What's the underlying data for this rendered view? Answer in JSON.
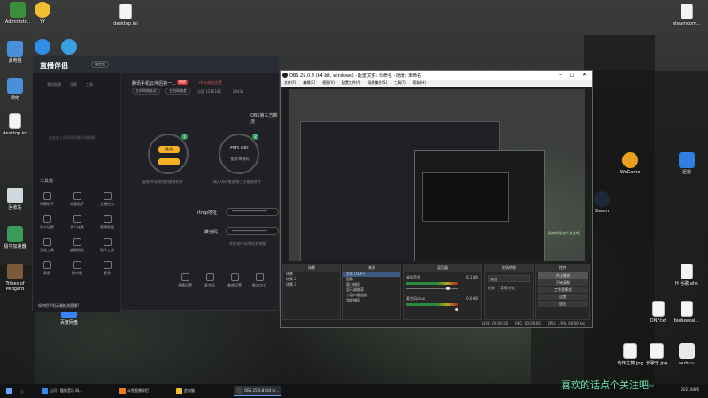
{
  "desktop": {
    "icons": [
      {
        "label": "Administr...",
        "color": "#3a8f3a"
      },
      {
        "label": "YY",
        "color": "#f0c030"
      },
      {
        "label": "desktop.ini",
        "color": "#f4f4f4"
      },
      {
        "label": "steamcom...",
        "color": "#f4f4f4"
      },
      {
        "label": "此电脑",
        "color": "#4a90d9"
      },
      {
        "label": "网络",
        "color": "#4a90d9"
      },
      {
        "label": "desktop.ini",
        "color": "#f4f4f4"
      },
      {
        "label": "回收站",
        "color": "#cfd8dc"
      },
      {
        "label": "极牛加速器",
        "color": "#3a9a5a"
      },
      {
        "label": "Tribes of Midgard",
        "color": "#7a5a3a"
      },
      {
        "label": "百度网盘",
        "color": "#3b82f6"
      },
      {
        "label": "WeGame",
        "color": "#e8a020"
      },
      {
        "label": "迅雷",
        "color": "#2f7fe0"
      },
      {
        "label": "Steam",
        "color": "#1b2838"
      },
      {
        "label": "H 谷歌.ahk",
        "color": "#f4f4f4"
      },
      {
        "label": "DNF.txt",
        "color": "#f4f4f4"
      },
      {
        "label": "bieluwkai...",
        "color": "#f4f4f4"
      },
      {
        "label": "动作之势.jpg",
        "color": "#f4f4f4"
      },
      {
        "label": "长歌乐.jpg",
        "color": "#f4f4f4"
      },
      {
        "label": "wuhu~",
        "color": "#f4f4f4"
      }
    ]
  },
  "zb": {
    "logo": "直播伴侣",
    "version": "稳定版",
    "tabs": [
      "我的直播",
      "场景",
      "工具"
    ],
    "empty": "点击右上角添加场景开始直播",
    "tools_title": "工具箱",
    "tools": [
      "弹幕助手",
      "房管助手",
      "主播任务",
      "观众连麦",
      "多人连麦",
      "直播数据",
      "音效工具",
      "超级粉丝",
      "动作工具",
      "录屏",
      "画中画",
      "更多"
    ],
    "title": "腾讯手机云伴侣第一...",
    "badge": "播放",
    "link": "rtmp地址设置",
    "chips": [
      "主机网络延迟",
      "主机网络差"
    ],
    "meta": [
      "分区 1216182",
      "2043k"
    ],
    "obs_label": "OBS第三方推流",
    "circle1": "推流",
    "circle2_title": "FMS URL",
    "circle2_sub": "推流/串流码",
    "cap1": "复制rtmp地址到推流软件",
    "cap2": "填入OBS推流/第三方推流软件",
    "rtmp_label": "rtmp地址",
    "rtmp_value": "********************",
    "code_label": "推流码",
    "code_value": "********************",
    "hint": "本推流rtmp地址有效期",
    "footer": "如何把手机云端推流直播?",
    "bottom_tools": [
      "直播设置",
      "麦克风",
      "美颜设置",
      "推流方式"
    ]
  },
  "obs": {
    "title": "OBS 25.0.8 (64 bit, windows) - 配置文件: 未命名 - 场景: 未命名",
    "menu": [
      "文件(F)",
      "编辑(E)",
      "视图(V)",
      "配置文件(P)",
      "场景集合(S)",
      "工具(T)",
      "帮助(H)"
    ],
    "preview_text": "喜欢的话点个关注吧",
    "docks": {
      "scenes_title": "场景",
      "scenes": [
        "场景",
        "场景 2",
        "场景 3"
      ],
      "sources_title": "来源",
      "sources": [
        "文本 (GDI+)",
        "图像",
        "窗口捕获",
        "显示器捕获",
        "小窗口播放器",
        "游戏捕获"
      ],
      "mixer_title": "混音器",
      "mixer": [
        {
          "name": "桌面音频",
          "db": "-6.1 dB"
        },
        {
          "name": "麦克风/Aux",
          "db": "0.0 dB"
        }
      ],
      "transitions_title": "转场特效",
      "transition_name": "淡出",
      "duration_label": "时长",
      "duration_value": "250 ms",
      "controls_title": "控件",
      "controls": [
        "停止推流",
        "开始录制",
        "工作室模式",
        "设置",
        "退出"
      ]
    },
    "status": [
      "LIVE: 00:00:00",
      "REC: 00:00:00",
      "CPU: 1.9%, 60.00 fps"
    ]
  },
  "taskbar": {
    "items": [
      "山河 - 酷狗音乐 网...",
      "斗鱼直播伴侣",
      "此电脑",
      "OBS 25.0.8 (64 bi..."
    ],
    "tray_time": "2021/08/6"
  },
  "overlay_text": "喜欢的话点个关注吧~"
}
